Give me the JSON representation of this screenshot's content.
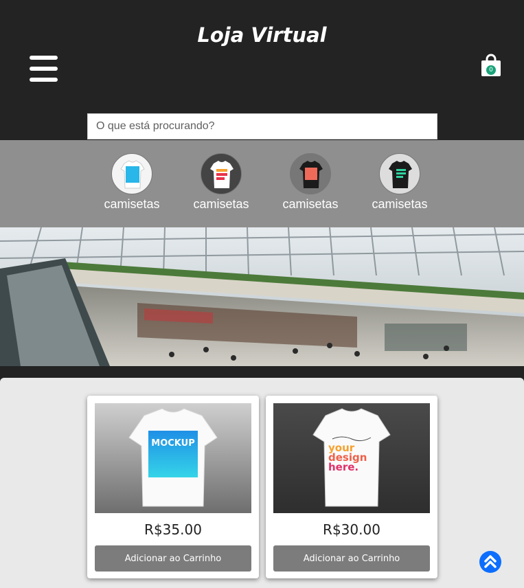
{
  "header": {
    "title": "Loja Virtual",
    "cart_count": "0"
  },
  "search": {
    "placeholder": "O que está procurando?"
  },
  "categories": [
    {
      "label": "camisetas"
    },
    {
      "label": "camisetas"
    },
    {
      "label": "camisetas"
    },
    {
      "label": "camisetas"
    }
  ],
  "products": [
    {
      "price": "R$35.00",
      "button_label": "Adicionar ao Carrinho",
      "shirt_text": "MOCKUP"
    },
    {
      "price": "R$30.00",
      "button_label": "Adicionar ao Carrinho",
      "shirt_text_1": "your",
      "shirt_text_2": "design",
      "shirt_text_3": "here."
    }
  ],
  "colors": {
    "header_bg": "#232323",
    "category_bar": "#8f8f8f",
    "products_bg": "#e9e9e9",
    "button_bg": "#7c7c7c",
    "cart_badge": "#1aa37a",
    "scroll_top": "#0d6efd"
  },
  "icons": {
    "menu": "hamburger-icon",
    "cart": "shopping-bag-icon",
    "scroll_top": "chevron-up-icon"
  }
}
